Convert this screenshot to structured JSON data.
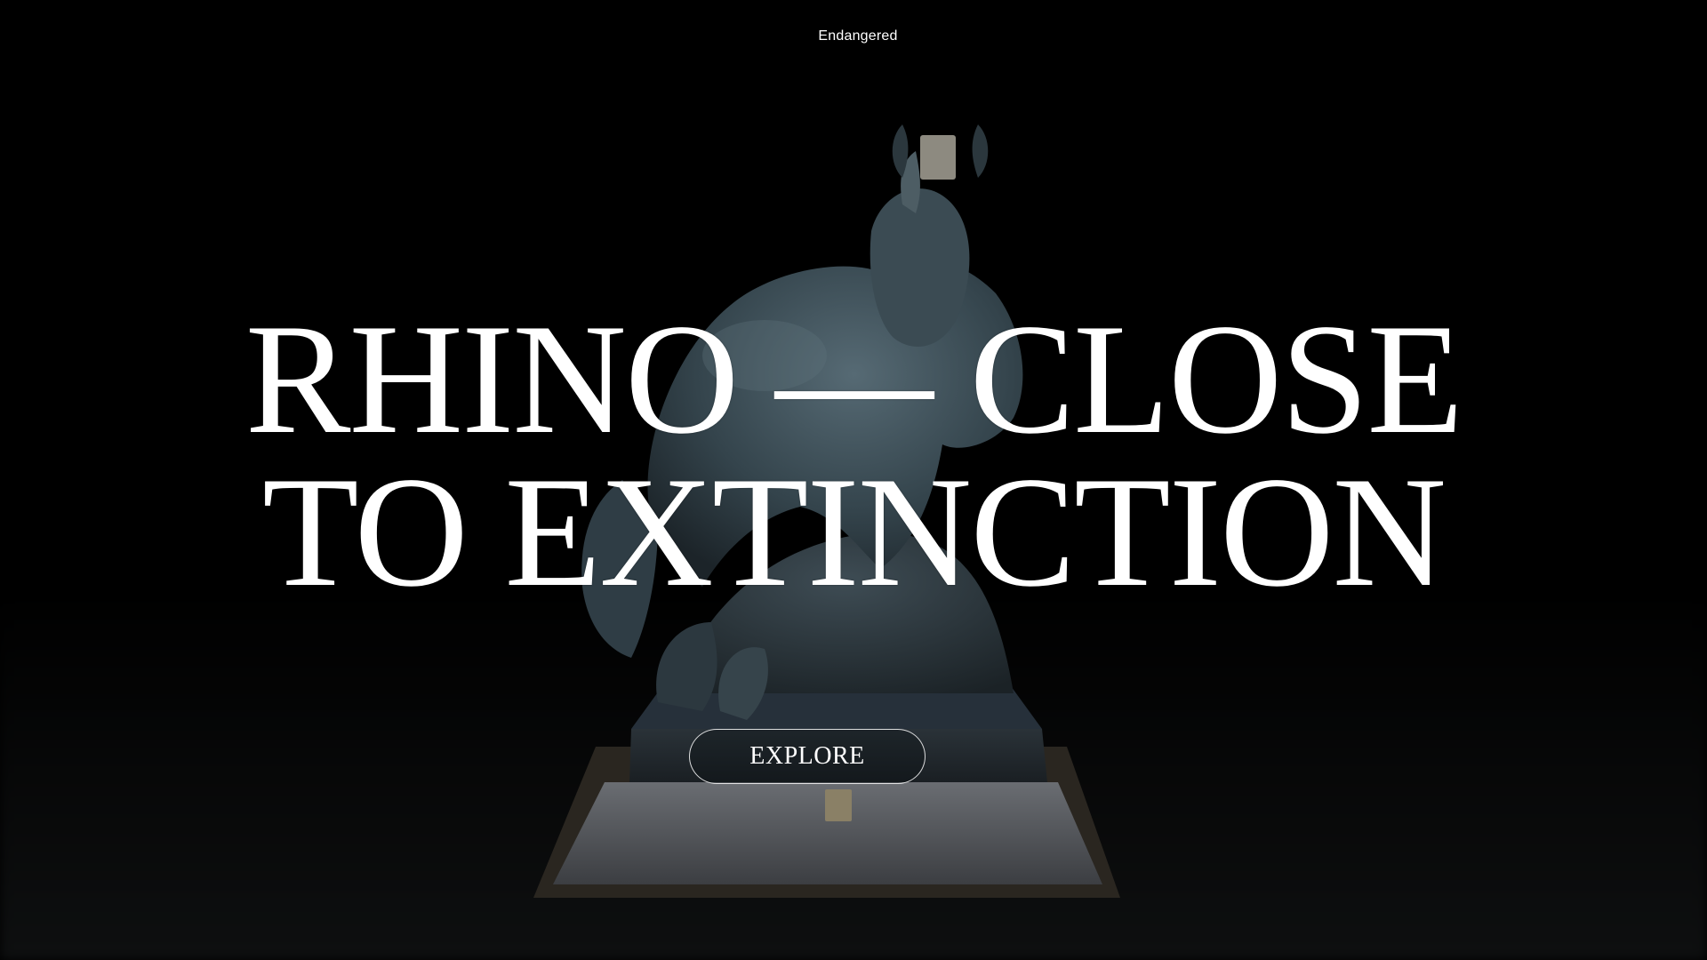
{
  "header": {
    "label": "Endangered"
  },
  "hero": {
    "headline_line1": "RHINO — CLOSE",
    "headline_line2": "TO EXTINCTION",
    "cta_label": "EXPLORE"
  },
  "colors": {
    "background": "#000000",
    "text": "#ffffff",
    "sculpture_tone": "#3a4a52",
    "pedestal": "#5a5d62"
  },
  "imagery": {
    "subject": "rhino-sculpture-on-pedestal"
  }
}
